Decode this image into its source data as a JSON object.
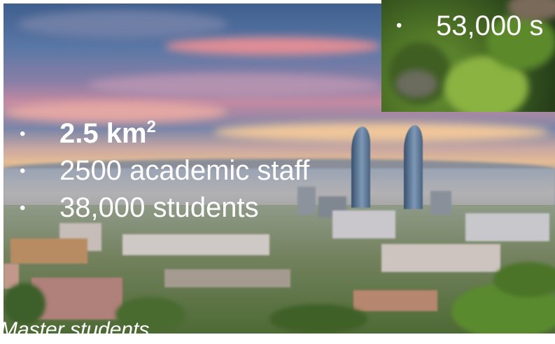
{
  "slide": {
    "bullets": [
      {
        "text": "2.5 km",
        "sup": "2",
        "bold": true
      },
      {
        "text": "2500 academic staff"
      },
      {
        "text": "38,000 students"
      }
    ],
    "bullet_glyph": "•",
    "inset_bullet": {
      "text": "53,000 s"
    },
    "cut_caption": "Master students"
  },
  "colors": {
    "text": "#ffffff",
    "sky": "#5c78a6",
    "vegetation": "#4d6a34"
  }
}
